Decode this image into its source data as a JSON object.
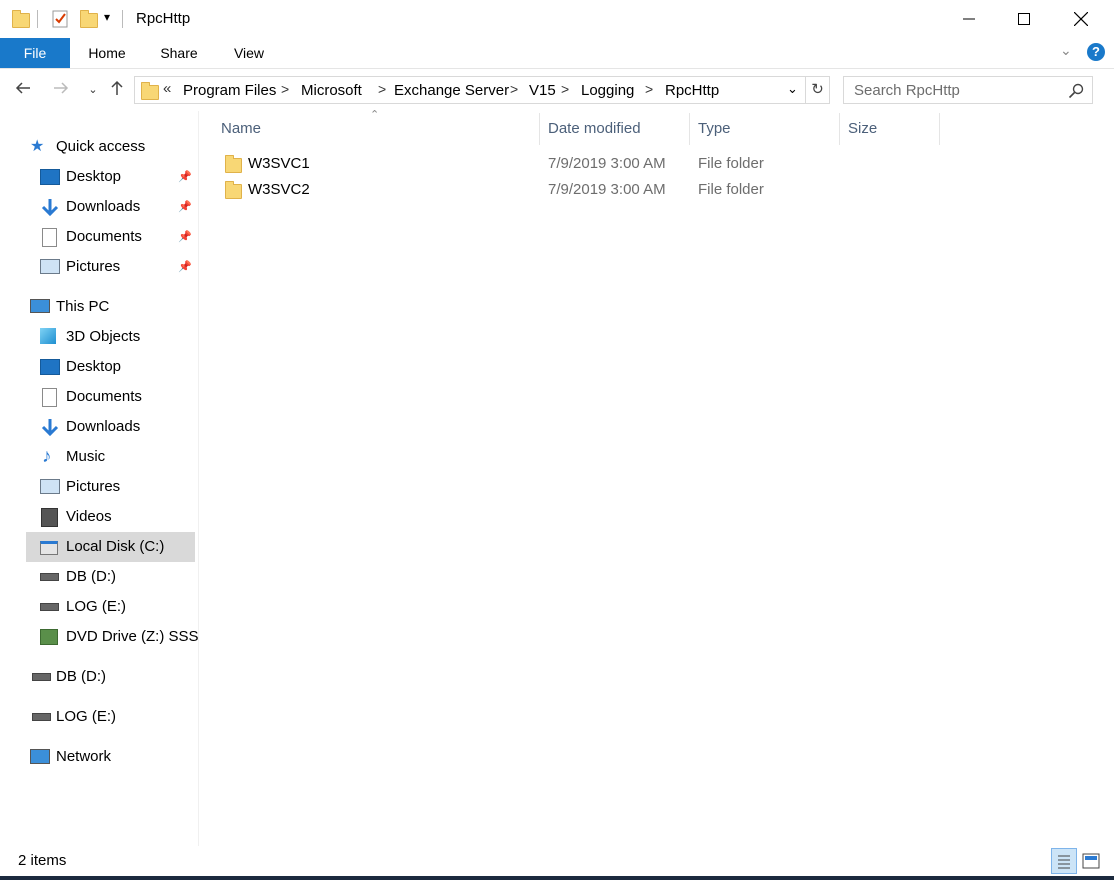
{
  "window": {
    "title": "RpcHttp",
    "minimize": "—",
    "maximize": "☐",
    "close": "✕"
  },
  "ribbon": {
    "tabs": [
      {
        "label": "File"
      },
      {
        "label": "Home"
      },
      {
        "label": "Share"
      },
      {
        "label": "View"
      }
    ],
    "help": "?"
  },
  "address": {
    "overflow": "«",
    "crumbs": [
      "Program Files",
      "Microsoft",
      "Exchange Server",
      "V15",
      "Logging",
      "RpcHttp"
    ],
    "separator": ">",
    "search_placeholder": "Search RpcHttp"
  },
  "nav": {
    "quick_access": {
      "label": "Quick access",
      "items": [
        {
          "label": "Desktop",
          "icon": "desktop-icon"
        },
        {
          "label": "Downloads",
          "icon": "downloads-icon"
        },
        {
          "label": "Documents",
          "icon": "documents-icon"
        },
        {
          "label": "Pictures",
          "icon": "pictures-icon"
        }
      ]
    },
    "this_pc": {
      "label": "This PC",
      "items": [
        {
          "label": "3D Objects",
          "icon": "3d-objects-icon"
        },
        {
          "label": "Desktop",
          "icon": "desktop-icon"
        },
        {
          "label": "Documents",
          "icon": "documents-icon"
        },
        {
          "label": "Downloads",
          "icon": "downloads-icon"
        },
        {
          "label": "Music",
          "icon": "music-icon"
        },
        {
          "label": "Pictures",
          "icon": "pictures-icon"
        },
        {
          "label": "Videos",
          "icon": "videos-icon"
        },
        {
          "label": "Local Disk (C:)",
          "icon": "local-disk-icon",
          "selected": true
        },
        {
          "label": "DB (D:)",
          "icon": "drive-icon"
        },
        {
          "label": "LOG (E:)",
          "icon": "drive-icon"
        },
        {
          "label": "DVD Drive (Z:) SSS_X",
          "icon": "dvd-drive-icon"
        }
      ]
    },
    "drives": [
      {
        "label": "DB (D:)"
      },
      {
        "label": "LOG (E:)"
      }
    ],
    "network": {
      "label": "Network"
    }
  },
  "columns": {
    "name": "Name",
    "date": "Date modified",
    "type": "Type",
    "size": "Size"
  },
  "files": [
    {
      "name": "W3SVC1",
      "date": "7/9/2019 3:00 AM",
      "type": "File folder",
      "size": ""
    },
    {
      "name": "W3SVC2",
      "date": "7/9/2019 3:00 AM",
      "type": "File folder",
      "size": ""
    }
  ],
  "status": {
    "item_count": "2 items"
  },
  "colors": {
    "file_tab": "#1979ca",
    "selected": "#d9d9d9",
    "header_text": "#4c607a",
    "folder": "#f8d775"
  }
}
